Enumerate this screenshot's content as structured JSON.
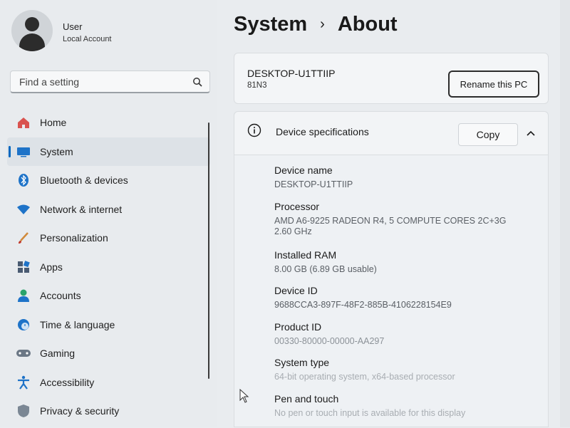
{
  "user": {
    "name": "User",
    "account_type": "Local Account"
  },
  "search": {
    "placeholder": "Find a setting"
  },
  "nav": {
    "items": [
      {
        "label": "Home",
        "icon": "home-icon"
      },
      {
        "label": "System",
        "icon": "system-icon",
        "active": true
      },
      {
        "label": "Bluetooth & devices",
        "icon": "bluetooth-icon"
      },
      {
        "label": "Network & internet",
        "icon": "wifi-icon"
      },
      {
        "label": "Personalization",
        "icon": "brush-icon"
      },
      {
        "label": "Apps",
        "icon": "apps-icon"
      },
      {
        "label": "Accounts",
        "icon": "person-icon"
      },
      {
        "label": "Time & language",
        "icon": "globe-clock-icon"
      },
      {
        "label": "Gaming",
        "icon": "gamepad-icon"
      },
      {
        "label": "Accessibility",
        "icon": "accessibility-icon"
      },
      {
        "label": "Privacy & security",
        "icon": "shield-icon"
      }
    ]
  },
  "breadcrumb": {
    "parent": "System",
    "separator": "›",
    "current": "About"
  },
  "pc": {
    "name": "DESKTOP-U1TTIIP",
    "model": "81N3",
    "rename_label": "Rename this PC"
  },
  "specs": {
    "title": "Device specifications",
    "copy_label": "Copy",
    "rows": [
      {
        "label": "Device name",
        "value": "DESKTOP-U1TTIIP"
      },
      {
        "label": "Processor",
        "value": "AMD A6-9225 RADEON R4, 5 COMPUTE CORES 2C+3G",
        "value2": "2.60 GHz"
      },
      {
        "label": "Installed RAM",
        "value": "8.00 GB (6.89 GB usable)"
      },
      {
        "label": "Device ID",
        "value": "9688CCA3-897F-48F2-885B-4106228154E9"
      },
      {
        "label": "Product ID",
        "value": "00330-80000-00000-AA297"
      },
      {
        "label": "System type",
        "value": "64-bit operating system, x64-based processor"
      },
      {
        "label": "Pen and touch",
        "value": "No pen or touch input is available for this display"
      }
    ]
  },
  "colors": {
    "accent": "#0067c0",
    "background": "#e9ecef",
    "card": "#f3f5f7"
  }
}
